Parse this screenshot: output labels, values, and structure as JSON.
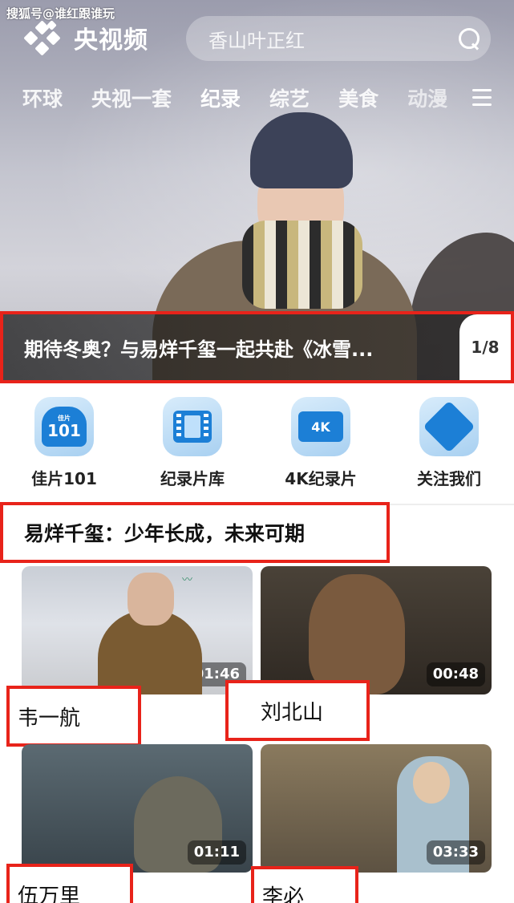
{
  "watermark": "搜狐号@谁红跟谁玩",
  "header": {
    "app_name": "央视频",
    "search_placeholder": "香山叶正红",
    "tabs": [
      "环球",
      "央视一套",
      "纪录",
      "综艺",
      "美食",
      "动漫"
    ],
    "active_tab": "纪录"
  },
  "banner": {
    "title": "期待冬奥？与易烊千玺一起共赴《冰雪...",
    "pager": "1/8"
  },
  "quick_entries": [
    {
      "label": "佳片101",
      "icon": "jiapian-101-icon",
      "icon_text": "101",
      "icon_small": "佳片"
    },
    {
      "label": "纪录片库",
      "icon": "film-library-icon"
    },
    {
      "label": "4K纪录片",
      "icon": "4k-documentary-icon",
      "icon_text": "4K"
    },
    {
      "label": "关注我们",
      "icon": "follow-us-icon"
    }
  ],
  "section": {
    "title": "易烊千玺：少年长成，未来可期",
    "videos": [
      {
        "name": "韦一航",
        "duration": "01:46"
      },
      {
        "name": "刘北山",
        "duration": "00:48"
      },
      {
        "name": "伍万里",
        "duration": "01:11"
      },
      {
        "name": "李必",
        "duration": "03:33"
      }
    ]
  },
  "colors": {
    "highlight_border": "#e8231a",
    "brand_blue": "#1c7fd6"
  }
}
